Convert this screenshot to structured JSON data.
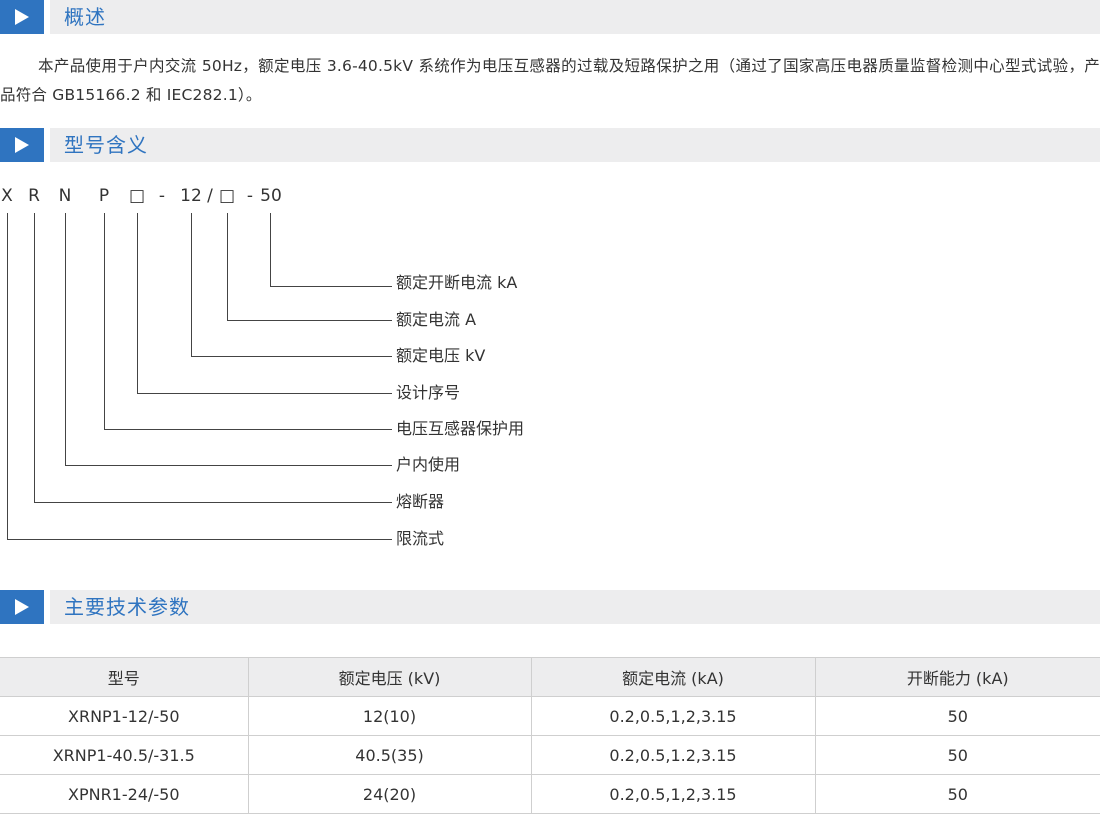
{
  "sections": {
    "overview": {
      "title": "概述"
    },
    "model_meaning": {
      "title": "型号含义"
    },
    "tech_params": {
      "title": "主要技术参数"
    }
  },
  "overview_text": "本产品使用于户内交流 50Hz，额定电压 3.6-40.5kV 系统作为电压互感器的过载及短路保护之用（通过了国家高压电器质量监督检测中心型式试验，产品符合 GB15166.2 和 IEC282.1）。",
  "model_code": {
    "c1": "X",
    "c2": "R",
    "c3": "N",
    "c4": "P",
    "c5": "□",
    "d1": "-",
    "c6": "12",
    "slash": "/",
    "c7": "□",
    "d2": "-",
    "c8": "50"
  },
  "model_labels": {
    "l1": "额定开断电流 kA",
    "l2": "额定电流 A",
    "l3": "额定电压 kV",
    "l4": "设计序号",
    "l5": "电压互感器保护用",
    "l6": "户内使用",
    "l7": "熔断器",
    "l8": "限流式"
  },
  "table": {
    "headers": [
      "型号",
      "额定电压 (kV)",
      "额定电流 (kA)",
      "开断能力 (kA)"
    ],
    "rows": [
      [
        "XRNP1-12/-50",
        "12(10)",
        "0.2,0.5,1,2,3.15",
        "50"
      ],
      [
        "XRNP1-40.5/-31.5",
        "40.5(35)",
        "0.2,0.5,1.2,3.15",
        "50"
      ],
      [
        "XPNR1-24/-50",
        "24(20)",
        "0.2,0.5,1,2,3.15",
        "50"
      ]
    ]
  },
  "colors": {
    "accent": "#2f74c0",
    "header_bg": "#ededee",
    "text": "#333333"
  }
}
